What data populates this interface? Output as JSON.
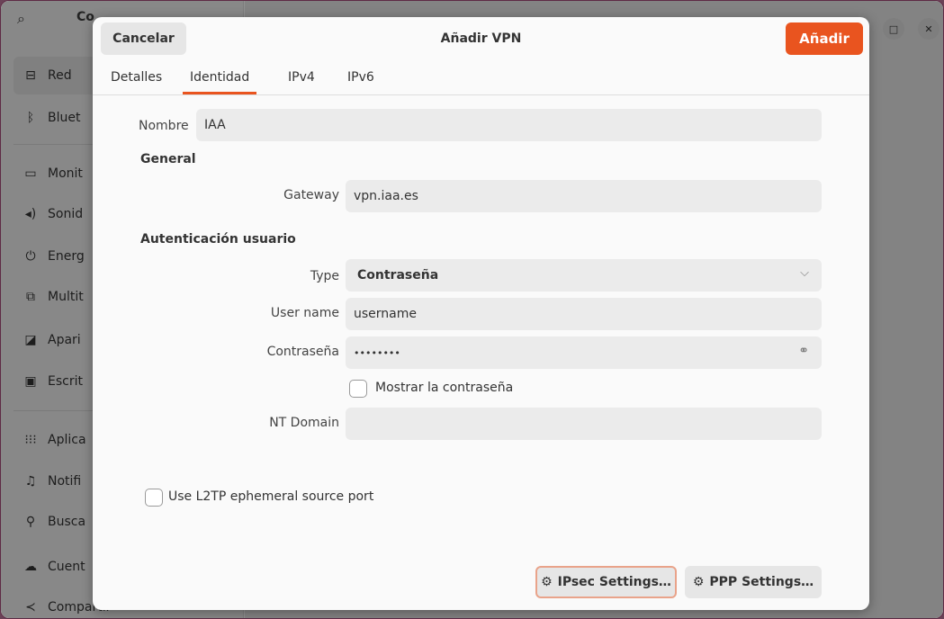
{
  "sidebar": {
    "title": "Co",
    "items": [
      {
        "icon": "network-icon",
        "glyph": "⊟",
        "label": "Red"
      },
      {
        "icon": "bluetooth-icon",
        "glyph": "ᛒ",
        "label": "Bluet"
      },
      {
        "icon": "monitor-icon",
        "glyph": "▭",
        "label": "Monit"
      },
      {
        "icon": "sound-icon",
        "glyph": "◂)",
        "label": "Sonid"
      },
      {
        "icon": "power-icon",
        "glyph": "⏻",
        "label": "Energ"
      },
      {
        "icon": "multitasking-icon",
        "glyph": "⧉",
        "label": "Multit"
      },
      {
        "icon": "appearance-icon",
        "glyph": "◪",
        "label": "Apari"
      },
      {
        "icon": "desktop-icon",
        "glyph": "▣",
        "label": "Escrit"
      },
      {
        "icon": "apps-icon",
        "glyph": "⁝⁝⁝",
        "label": "Aplica"
      },
      {
        "icon": "notifications-icon",
        "glyph": "♫",
        "label": "Notifi"
      },
      {
        "icon": "search-icon",
        "glyph": "⚲",
        "label": "Busca"
      },
      {
        "icon": "online-accounts-icon",
        "glyph": "☁",
        "label": "Cuent"
      },
      {
        "icon": "sharing-icon",
        "glyph": "≺",
        "label": "Compartir"
      }
    ]
  },
  "dialog": {
    "cancel_label": "Cancelar",
    "title": "Añadir VPN",
    "add_label": "Añadir",
    "tabs": [
      {
        "label": "Detalles"
      },
      {
        "label": "Identidad"
      },
      {
        "label": "IPv4"
      },
      {
        "label": "IPv6"
      }
    ],
    "name_label": "Nombre",
    "name_value": "IAA",
    "general_heading": "General",
    "gateway_label": "Gateway",
    "gateway_value": "vpn.iaa.es",
    "auth_heading": "Autenticación usuario",
    "type_label": "Type",
    "type_value": "Contraseña",
    "username_label": "User name",
    "username_value": "username",
    "password_label": "Contraseña",
    "password_value": "••••••••",
    "show_password_label": "Mostrar la contraseña",
    "show_password_checked": false,
    "ntdomain_label": "NT Domain",
    "ntdomain_value": "",
    "l2tp_label": "Use L2TP ephemeral source port",
    "l2tp_checked": false,
    "ipsec_label": "IPsec Settings…",
    "ppp_label": "PPP Settings…"
  },
  "colors": {
    "accent": "#e9541f"
  }
}
